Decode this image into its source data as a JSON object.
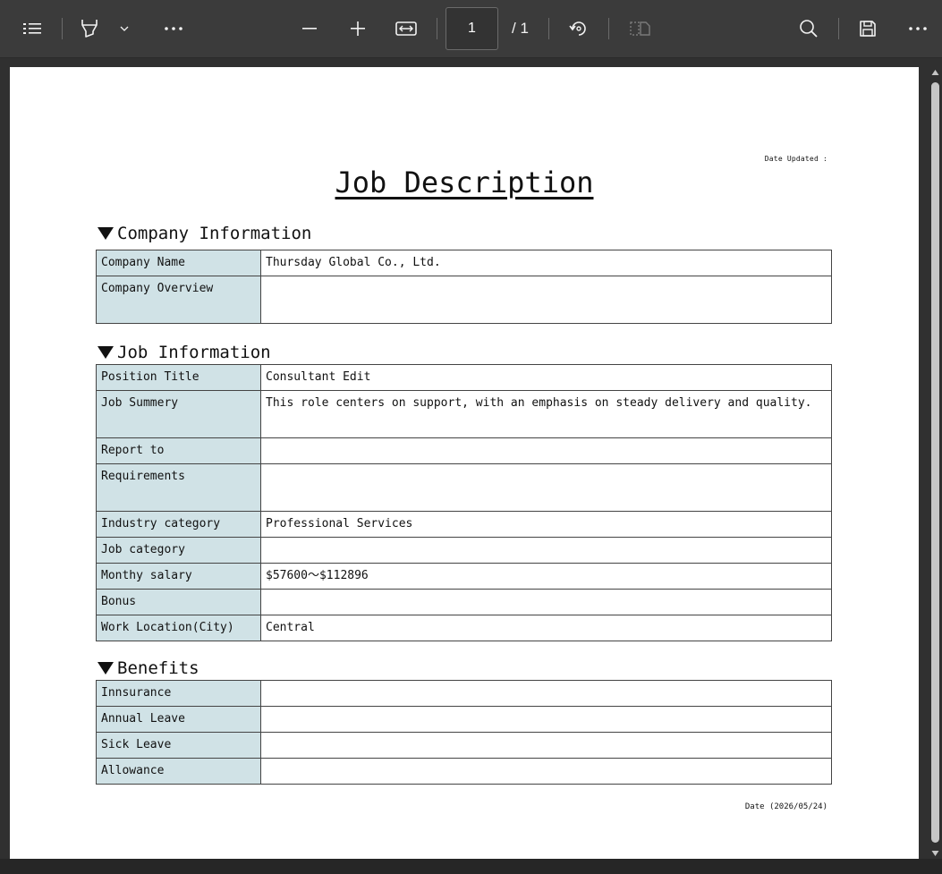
{
  "toolbar": {
    "page_current": "1",
    "page_total": "/ 1",
    "icons": [
      "contents-icon",
      "highlight-icon",
      "chevron-down-icon",
      "more-icon",
      "zoom-out-icon",
      "zoom-in-icon",
      "fit-width-icon",
      "rotate-icon",
      "two-page-icon",
      "search-icon",
      "save-icon",
      "more-options-icon"
    ]
  },
  "document": {
    "date_updated": "Date Updated :",
    "title": "Job Description",
    "sections": {
      "company": {
        "heading": "Company Information",
        "rows": [
          {
            "label": "Company Name",
            "value": "Thursday Global Co., Ltd."
          },
          {
            "label": "Company Overview",
            "value": ""
          }
        ]
      },
      "job": {
        "heading": "Job Information",
        "rows": [
          {
            "label": "Position Title",
            "value": "Consultant Edit"
          },
          {
            "label": "Job Summery",
            "value": "This role centers on support, with an emphasis on steady delivery and quality."
          },
          {
            "label": "Report to",
            "value": ""
          },
          {
            "label": "Requirements",
            "value": ""
          },
          {
            "label": "Industry category",
            "value": "Professional Services"
          },
          {
            "label": "Job category",
            "value": ""
          },
          {
            "label": "Monthy salary",
            "value": "$57600～$112896"
          },
          {
            "label": "Bonus",
            "value": ""
          },
          {
            "label": "Work Location(City)",
            "value": "Central"
          }
        ]
      },
      "benefits": {
        "heading": "Benefits",
        "rows": [
          {
            "label": "Innsurance",
            "value": ""
          },
          {
            "label": "Annual Leave",
            "value": ""
          },
          {
            "label": "Sick Leave",
            "value": ""
          },
          {
            "label": "Allowance",
            "value": ""
          }
        ]
      }
    },
    "footer_date": "Date (2026/05/24)"
  },
  "colors": {
    "toolbar_bg": "#3b3b3b",
    "label_cell_bg": "#d0e2e6",
    "viewer_bg": "#303030"
  }
}
